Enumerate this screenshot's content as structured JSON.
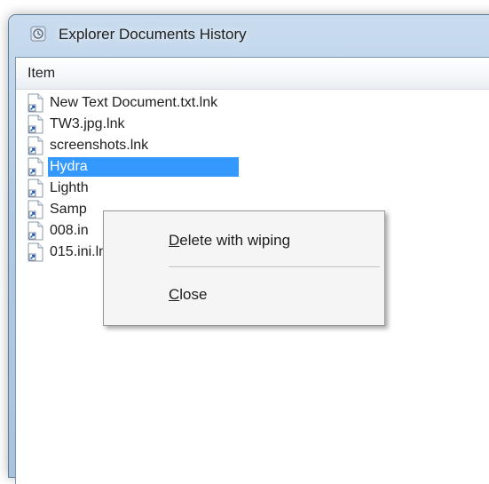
{
  "window": {
    "title": "Explorer Documents History",
    "icon": "history-app-icon"
  },
  "list": {
    "column_header": "Item",
    "items": [
      {
        "label": "New Text Document.txt.lnk",
        "icon": "shortcut-file-icon",
        "selected": false
      },
      {
        "label": "TW3.jpg.lnk",
        "icon": "shortcut-file-icon",
        "selected": false
      },
      {
        "label": "screenshots.lnk",
        "icon": "shortcut-file-icon",
        "selected": false
      },
      {
        "label": "Hydra",
        "icon": "shortcut-file-icon",
        "selected": true
      },
      {
        "label": "Lighth",
        "icon": "shortcut-file-icon",
        "selected": false
      },
      {
        "label": "Samp",
        "icon": "shortcut-file-icon",
        "selected": false
      },
      {
        "label": "008.in",
        "icon": "shortcut-file-icon",
        "selected": false
      },
      {
        "label": "015.ini.lnk",
        "icon": "shortcut-file-icon",
        "selected": false
      }
    ]
  },
  "context_menu": {
    "items": [
      {
        "mnemonic": "D",
        "rest": "elete with wiping"
      },
      {
        "mnemonic": "C",
        "rest": "lose"
      }
    ]
  },
  "colors": {
    "selection": "#3399ff",
    "menu_background": "#f5f5f5"
  }
}
